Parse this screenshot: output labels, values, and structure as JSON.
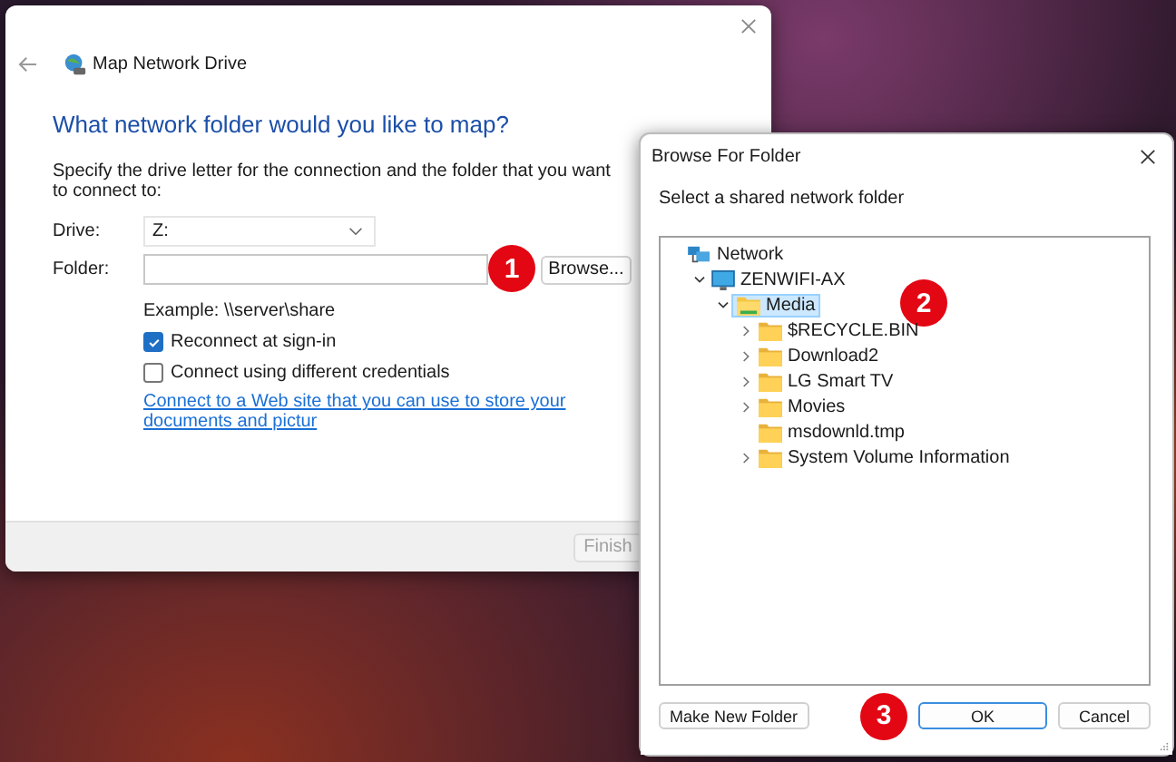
{
  "main_window": {
    "title": "Map Network Drive",
    "heading": "What network folder would you like to map?",
    "instruction": "Specify the drive letter for the connection and the folder that you want to connect to:",
    "drive": {
      "label": "Drive:",
      "value": "Z:"
    },
    "folder": {
      "label": "Folder:",
      "callout": "1",
      "browse_button": "Browse..."
    },
    "example": "Example: \\\\server\\share",
    "options": [
      {
        "label": "Reconnect at sign-in",
        "checked": true
      },
      {
        "label": "Connect using different credentials",
        "checked": false
      }
    ],
    "link": "Connect to a Web site that you can use to store your documents and pictur",
    "finish_button": {
      "label": "Finish",
      "disabled": true
    }
  },
  "browse_dialog": {
    "title": "Browse For Folder",
    "instruction": "Select a shared network folder",
    "tree": [
      {
        "label": "Network",
        "kind": "network",
        "selected": false,
        "children": [
          {
            "label": "ZENWIFI-AX",
            "kind": "computer",
            "expanded": true,
            "selected": false,
            "children": [
              {
                "label": "Media",
                "kind": "share",
                "expanded": true,
                "selected": true,
                "callout": "2",
                "children": [
                  {
                    "label": "$RECYCLE.BIN",
                    "kind": "folder",
                    "expanded": false,
                    "selected": false
                  },
                  {
                    "label": "Download2",
                    "kind": "folder",
                    "expanded": false,
                    "selected": false
                  },
                  {
                    "label": "LG Smart TV",
                    "kind": "folder",
                    "expanded": false,
                    "selected": false
                  },
                  {
                    "label": "Movies",
                    "kind": "folder",
                    "expanded": false,
                    "selected": false
                  },
                  {
                    "label": "msdownld.tmp",
                    "kind": "folder",
                    "selected": false
                  },
                  {
                    "label": "System Volume Information",
                    "kind": "folder",
                    "expanded": false,
                    "selected": false
                  }
                ]
              }
            ]
          }
        ]
      }
    ],
    "buttons": [
      {
        "label": "Make New Folder",
        "kind": "left"
      },
      {
        "label": "OK",
        "kind": "default",
        "callout": "3"
      },
      {
        "label": "Cancel",
        "kind": "normal"
      }
    ]
  }
}
